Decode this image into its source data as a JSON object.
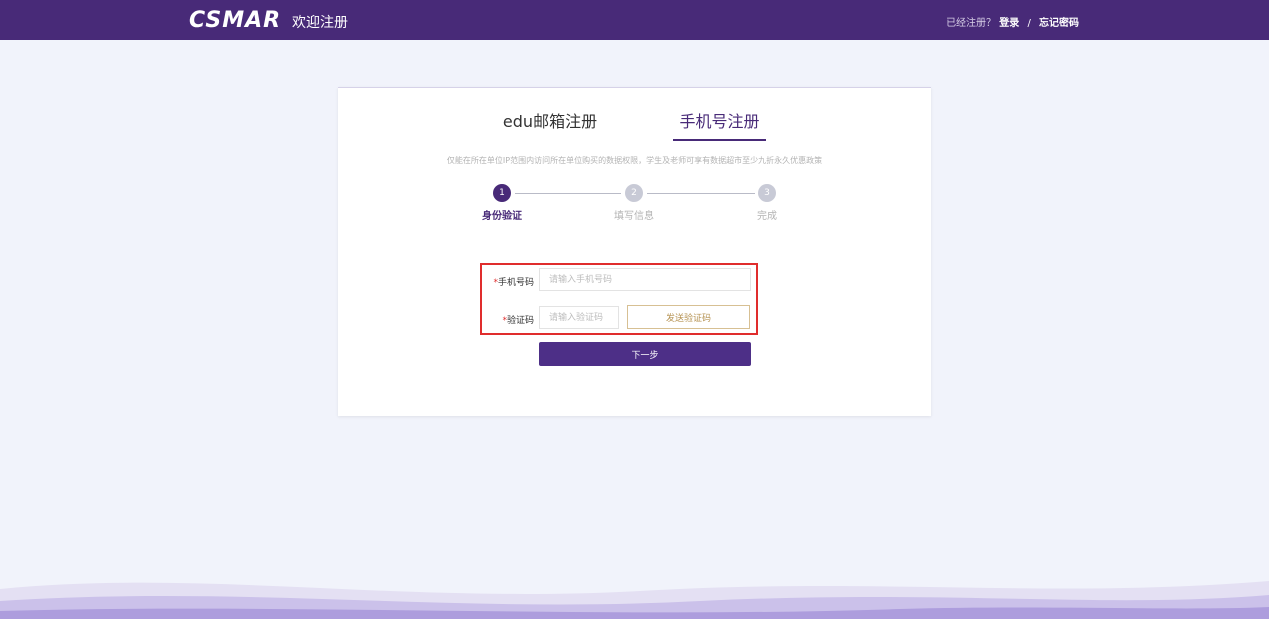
{
  "header": {
    "logo": "CSMAR",
    "title": "欢迎注册",
    "already_registered": "已经注册？",
    "login": "登录",
    "separator": "/",
    "forgot_password": "忘记密码"
  },
  "tabs": [
    {
      "label": "edu邮箱注册",
      "active": false
    },
    {
      "label": "手机号注册",
      "active": true
    }
  ],
  "notice": "仅能在所在单位IP范围内访问所在单位购买的数据权限，学生及老师可享有数据超市至少九折永久优惠政策",
  "steps": [
    {
      "number": "1",
      "label": "身份验证",
      "active": true
    },
    {
      "number": "2",
      "label": "填写信息",
      "active": false
    },
    {
      "number": "3",
      "label": "完成",
      "active": false
    }
  ],
  "form": {
    "required_mark": "*",
    "phone_label": "手机号码",
    "phone_placeholder": "请输入手机号码",
    "code_label": "验证码",
    "code_placeholder": "请输入验证码",
    "send_code": "发送验证码",
    "next": "下一步"
  },
  "colors": {
    "brand": "#482a78",
    "highlight_border": "#e02d2d",
    "send_button": "#b69353"
  }
}
